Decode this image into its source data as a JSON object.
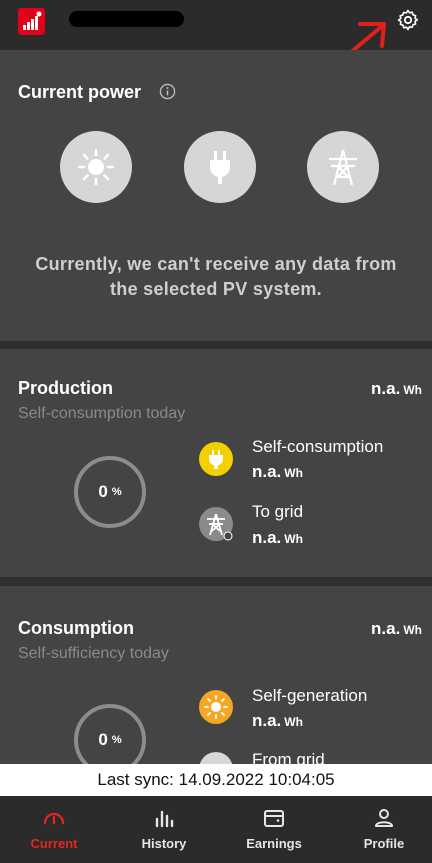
{
  "header": {
    "settings_icon": "gear-icon",
    "annotation_color": "#e0201b"
  },
  "current": {
    "title": "Current power",
    "no_data_message": "Currently, we can't receive any data from the selected PV system.",
    "icons": [
      "sun-icon",
      "plug-icon",
      "power-tower-icon"
    ]
  },
  "production": {
    "title": "Production",
    "value": "n.a.",
    "unit": "Wh",
    "subtitle": "Self-consumption today",
    "ring_value": "0",
    "ring_unit": "%",
    "items": [
      {
        "label": "Self-consumption",
        "value": "n.a.",
        "unit": "Wh",
        "icon": "plug-icon",
        "color": "#f5d000"
      },
      {
        "label": "To grid",
        "value": "n.a.",
        "unit": "Wh",
        "icon": "power-tower-icon",
        "color": "#8a8a8a"
      }
    ]
  },
  "consumption": {
    "title": "Consumption",
    "value": "n.a.",
    "unit": "Wh",
    "subtitle": "Self-sufficiency today",
    "ring_value": "0",
    "ring_unit": "%",
    "items": [
      {
        "label": "Self-generation",
        "value": "n.a.",
        "unit": "Wh",
        "icon": "sun-icon",
        "color": "#f5a623"
      },
      {
        "label": "From grid",
        "icon": "power-tower-icon",
        "color": "#d6d6d6"
      }
    ]
  },
  "sync": {
    "text": "Last sync: 14.09.2022 10:04:05"
  },
  "nav": {
    "items": [
      {
        "label": "Current",
        "icon": "gauge-icon",
        "active": true
      },
      {
        "label": "History",
        "icon": "bar-chart-icon",
        "active": false
      },
      {
        "label": "Earnings",
        "icon": "wallet-icon",
        "active": false
      },
      {
        "label": "Profile",
        "icon": "person-icon",
        "active": false
      }
    ],
    "active_color": "#e2281e"
  }
}
